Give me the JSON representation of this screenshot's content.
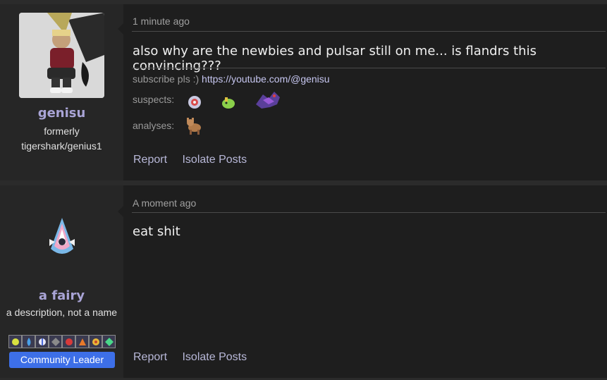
{
  "posts": [
    {
      "author": {
        "name": "genisu",
        "title": "formerly tigershark/genius1"
      },
      "time": "1 minute ago",
      "message": "also why are the newbies and pulsar still on me... is flandrs this convincing???",
      "signature": {
        "prefix": "subscribe pls :) ",
        "link": "https://youtube.com/@genisu"
      },
      "suspects_label": "suspects:",
      "analyses_label": "analyses:",
      "actions": {
        "report": "Report",
        "isolate": "Isolate Posts"
      }
    },
    {
      "author": {
        "name": "a fairy",
        "title": "a description, not a name",
        "role": "Community Leader"
      },
      "time": "A moment ago",
      "message": "eat shit",
      "actions": {
        "report": "Report",
        "isolate": "Isolate Posts"
      }
    }
  ],
  "colors": {
    "username": "#a9a4d6",
    "role_badge": "#3d6fe8",
    "post_bg": "#1e1e1e",
    "author_bg": "#262626"
  },
  "icons": {
    "suspects": [
      "pokemon-sprite-icon",
      "pokemon-sprite-icon",
      "pokemon-sprite-icon"
    ],
    "analyses": [
      "pokemon-sprite-icon"
    ],
    "badges": [
      "badge-icon",
      "badge-icon",
      "badge-icon",
      "badge-icon",
      "badge-icon",
      "badge-icon",
      "badge-icon",
      "badge-icon"
    ]
  }
}
